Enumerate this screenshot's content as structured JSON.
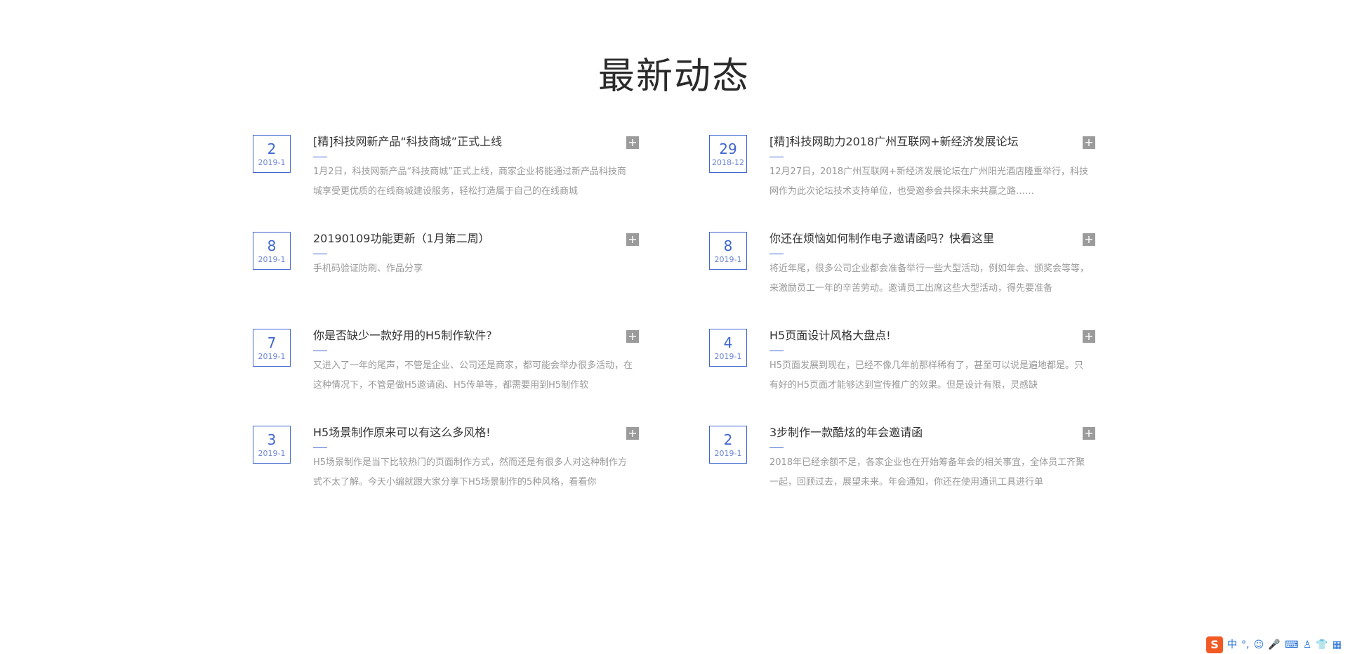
{
  "section": {
    "title": "最新动态"
  },
  "news": [
    {
      "day": "2",
      "ym": "2019-1",
      "title": "[精]科技网新产品“科技商城”正式上线",
      "desc": "1月2日，科技网新产品“科技商城”正式上线，商家企业将能通过新产品科技商城享受更优质的在线商城建设服务，轻松打造属于自己的在线商城"
    },
    {
      "day": "29",
      "ym": "2018-12",
      "title": "[精]科技网助力2018广州互联网+新经济发展论坛",
      "desc": "12月27日，2018广州互联网+新经济发展论坛在广州阳光酒店隆重举行，科技网作为此次论坛技术支持单位，也受邀参会共探未来共赢之路……"
    },
    {
      "day": "8",
      "ym": "2019-1",
      "title": "20190109功能更新（1月第二周）",
      "desc": "手机码验证防刷、作品分享"
    },
    {
      "day": "8",
      "ym": "2019-1",
      "title": "你还在烦恼如何制作电子邀请函吗？快看这里",
      "desc": "将近年尾，很多公司企业都会准备举行一些大型活动，例如年会、颁奖会等等，来激励员工一年的辛苦劳动。邀请员工出席这些大型活动，得先要准备"
    },
    {
      "day": "7",
      "ym": "2019-1",
      "title": "你是否缺少一款好用的H5制作软件?",
      "desc": "又进入了一年的尾声，不管是企业、公司还是商家，都可能会举办很多活动，在这种情况下，不管是做H5邀请函、H5传单等，都需要用到H5制作软"
    },
    {
      "day": "4",
      "ym": "2019-1",
      "title": "H5页面设计风格大盘点!",
      "desc": "H5页面发展到现在，已经不像几年前那样稀有了，甚至可以说是遍地都是。只有好的H5页面才能够达到宣传推广的效果。但是设计有限，灵感缺"
    },
    {
      "day": "3",
      "ym": "2019-1",
      "title": "H5场景制作原来可以有这么多风格!",
      "desc": "H5场景制作是当下比较热门的页面制作方式，然而还是有很多人对这种制作方式不太了解。今天小编就跟大家分享下H5场景制作的5种风格，看看你"
    },
    {
      "day": "2",
      "ym": "2019-1",
      "title": "3步制作一款酷炫的年会邀请函",
      "desc": "2018年已经余额不足，各家企业也在开始筹备年会的相关事宜，全体员工齐聚一起，回顾过去，展望未来。年会通知，你还在使用通讯工具进行单"
    }
  ],
  "plus_label": "+",
  "ime": {
    "logo": "S",
    "lang": "中",
    "punct": "°,",
    "emoji": "☺",
    "mic": "🎤",
    "keyboard": "⌨",
    "user": "♙",
    "shirt": "👕",
    "grid": "▦"
  }
}
